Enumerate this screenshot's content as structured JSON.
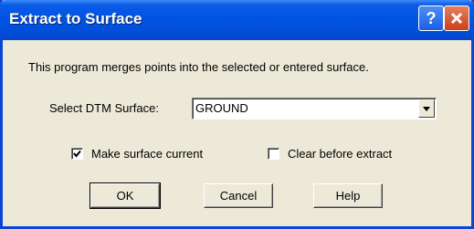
{
  "window": {
    "title": "Extract to Surface",
    "help_glyph": "?"
  },
  "description": "This program merges points into the selected or entered surface.",
  "dtm": {
    "label": "Select DTM Surface:",
    "value": "GROUND"
  },
  "options": [
    {
      "label": "Make surface current",
      "checked": true
    },
    {
      "label": "Clear before extract",
      "checked": false
    }
  ],
  "buttons": {
    "ok": "OK",
    "cancel": "Cancel",
    "help": "Help"
  },
  "colors": {
    "titlebar": "#0154e4",
    "face": "#ece9d8",
    "close": "#c9401b"
  },
  "icons": [
    "help-icon",
    "close-icon",
    "dropdown-arrow-icon",
    "checkmark-icon"
  ]
}
